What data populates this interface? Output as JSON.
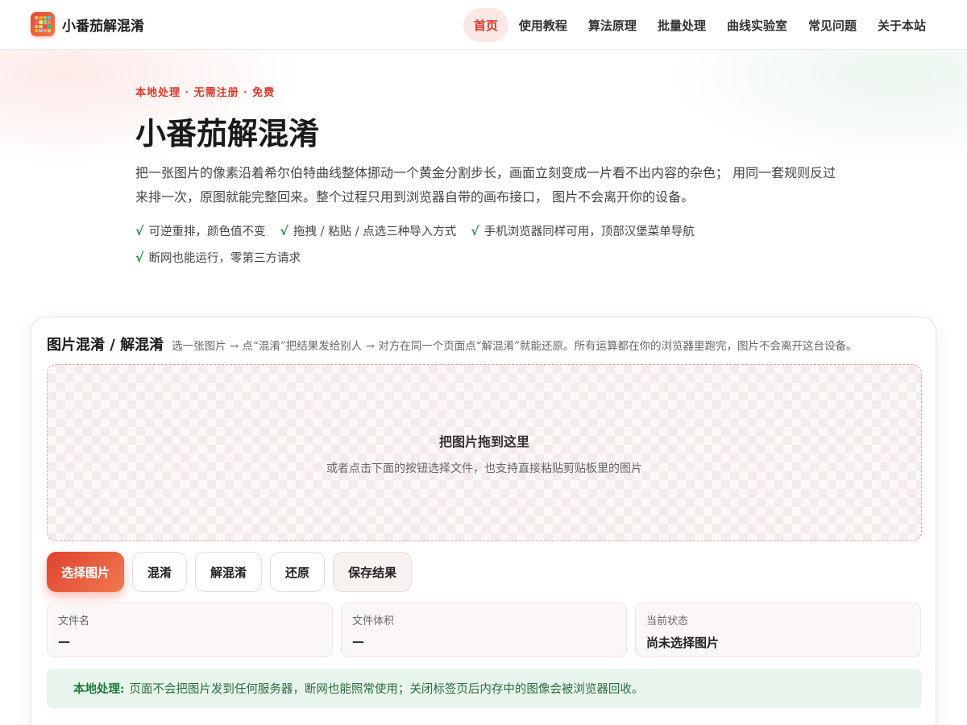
{
  "brand": {
    "name": "小番茄解混淆",
    "logo_icon": "pixel-grid-icon"
  },
  "nav": {
    "items": [
      {
        "label": "首页",
        "active": true
      },
      {
        "label": "使用教程",
        "active": false
      },
      {
        "label": "算法原理",
        "active": false
      },
      {
        "label": "批量处理",
        "active": false
      },
      {
        "label": "曲线实验室",
        "active": false
      },
      {
        "label": "常见问题",
        "active": false
      },
      {
        "label": "关于本站",
        "active": false
      }
    ]
  },
  "hero": {
    "eyebrow": "本地处理 · 无需注册 · 免费",
    "title": "小番茄解混淆",
    "description": "把一张图片的像素沿着希尔伯特曲线整体挪动一个黄金分割步长，画面立刻变成一片看不出内容的杂色； 用同一套规则反过来排一次，原图就能完整回来。整个过程只用到浏览器自带的画布接口， 图片不会离开你的设备。",
    "features": [
      "可逆重排，颜色值不变",
      "拖拽 / 粘贴 / 点选三种导入方式",
      "手机浏览器同样可用，顶部汉堡菜单导航",
      "断网也能运行，零第三方请求"
    ],
    "check_symbol": "√"
  },
  "tool": {
    "title": "图片混淆 / 解混淆",
    "subtitle": "选一张图片 → 点“混淆”把结果发给别人 → 对方在同一个页面点“解混淆”就能还原。所有运算都在你的浏览器里跑完，图片不会离开这台设备。",
    "dropzone": {
      "title": "把图片拖到这里",
      "hint": "或者点击下面的按钮选择文件，也支持直接粘贴剪贴板里的图片"
    },
    "buttons": {
      "select": "选择图片",
      "obfuscate": "混淆",
      "deobfuscate": "解混淆",
      "restore": "还原",
      "save": "保存结果"
    },
    "stats": {
      "filename_label": "文件名",
      "filename_value": "—",
      "filesize_label": "文件体积",
      "filesize_value": "—",
      "status_label": "当前状态",
      "status_value": "尚未选择图片"
    },
    "notice": {
      "label": "本地处理:",
      "text": "页面不会把图片发到任何服务器，断网也能照常使用；关闭标签页后内存中的图像会被浏览器回收。"
    }
  },
  "colors": {
    "accent": "#d9382a",
    "success": "#1e8a3c",
    "notice_bg": "#e8f5ec"
  }
}
